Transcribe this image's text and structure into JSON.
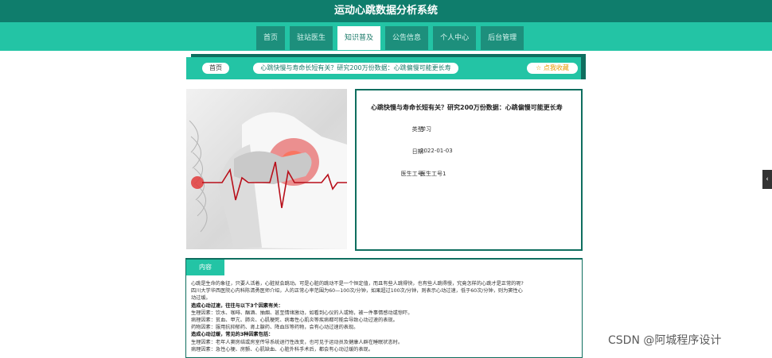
{
  "app": {
    "title": "运动心跳数据分析系统"
  },
  "nav": {
    "items": [
      {
        "label": "首页",
        "active": false
      },
      {
        "label": "驻站医生",
        "active": false
      },
      {
        "label": "知识普及",
        "active": true
      },
      {
        "label": "公告信息",
        "active": false
      },
      {
        "label": "个人中心",
        "active": false
      },
      {
        "label": "后台管理",
        "active": false
      }
    ]
  },
  "breadcrumb": {
    "home": "首页",
    "title": "心跳快慢与寿命长短有关？研究200万份数据：心跳偏慢可能更长寿",
    "favorite": "☆ 点我收藏"
  },
  "article": {
    "title": "心跳快慢与寿命长短有关？研究200万份数据：心跳偏慢可能更长寿",
    "fields": [
      {
        "label": "类型:",
        "value": "学习"
      },
      {
        "label": "日期:",
        "value": "2022-01-03"
      },
      {
        "label": "医生工号:",
        "value": "医生工号1"
      }
    ]
  },
  "content": {
    "tab": "内容",
    "lines": [
      {
        "text": "心跳是生命的象征，只要人活着，心脏就会跳动。可是心脏的跳动不是一个恒定值，而且有些人跳得快，也有些人跳得慢，究竟怎样的心跳才是正常的呢?",
        "bold": false
      },
      {
        "text": "四川大学华西医院心内科陈清勇医师介绍，人的正常心率范围为60—100次/分钟，如果超过100次/分钟，则表示心动过速，低于60次/分钟，则为窦性心",
        "bold": false
      },
      {
        "text": "动过缓。",
        "bold": false
      },
      {
        "text": "造成心动过速，往往与以下3个因素有关：",
        "bold": true
      },
      {
        "text": "生理因素：饮水、咖啡、酗酒、抽烟、甚至情绪激动，如看到心仪的人或物，被一件事情感动或惊吓。",
        "bold": false
      },
      {
        "text": "病理因素：贫血、甲亢、肺炎、心肌梗死、病毒性心肌炎等疾病都可能会导致心动过速的表现。",
        "bold": false
      },
      {
        "text": "药物因素：服用抗抑郁药、肾上腺药、降血压等药物，会有心动过速的表现。",
        "bold": false
      },
      {
        "text": "造成心动过缓，常见的3种因素包括：",
        "bold": true
      },
      {
        "text": "生理因素：老年人窦房结或房室传导系统退行性改变，也可见于运动员及健康人群在睡眠状态时。",
        "bold": false
      },
      {
        "text": "病理因素：急性心梗、房颤、心肌缺血、心脏外科手术后，都会有心动过缓的表现。",
        "bold": false
      }
    ]
  },
  "side": {
    "handle": "‹"
  },
  "watermark": "CSDN @阿城程序设计",
  "colors": {
    "header": "#0f7d6c",
    "accent": "#23c4a5",
    "dark": "#0f6e5f"
  }
}
